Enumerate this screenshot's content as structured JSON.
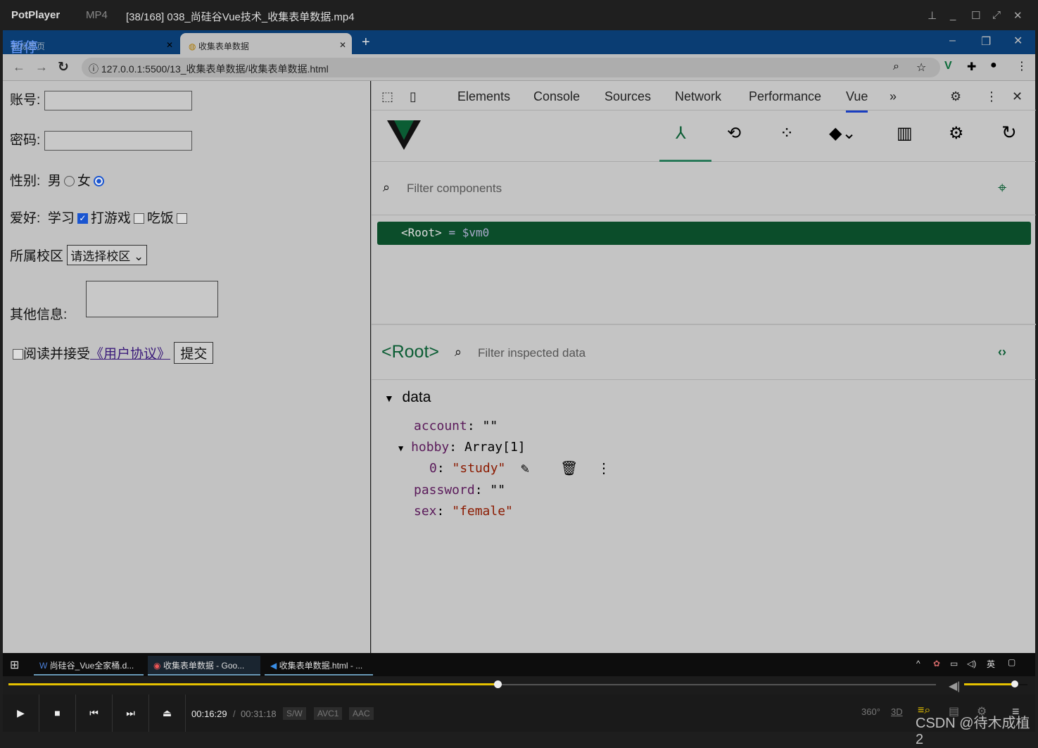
{
  "player": {
    "brand": "PotPlayer",
    "format": "MP4",
    "file_title": "[38/168] 038_尚硅谷Vue技术_收集表单数据.mp4",
    "overlay_status": "暂停"
  },
  "browser": {
    "tabs": [
      {
        "label": "新标签页"
      },
      {
        "label": "收集表单数据"
      }
    ],
    "url": "127.0.0.1:5500/13_收集表单数据/收集表单数据.html"
  },
  "form": {
    "account_label": "账号:",
    "password_label": "密码:",
    "sex_label": "性别:",
    "male": "男",
    "female": "女",
    "sex_value": "female",
    "hobby_label": "爱好:",
    "hobbies": [
      {
        "label": "学习",
        "checked": true
      },
      {
        "label": "打游戏",
        "checked": false
      },
      {
        "label": "吃饭",
        "checked": false
      }
    ],
    "campus_label": "所属校区",
    "campus_select": "请选择校区",
    "other_label": "其他信息:",
    "agree_text": "阅读并接受",
    "agreement_link": "《用户协议》",
    "submit": "提交"
  },
  "devtools": {
    "tabs": [
      "Elements",
      "Console",
      "Sources",
      "Network",
      "Performance",
      "Vue"
    ],
    "active_tab": "Vue",
    "filter_components_placeholder": "Filter components",
    "root_row": "<Root>",
    "root_alias": "= $vm0",
    "inspector_title": "<Root>",
    "filter_inspected_placeholder": "Filter inspected data",
    "section": "data",
    "fields": [
      {
        "key": "account",
        "value": "\"\""
      },
      {
        "key": "hobby",
        "value": "Array[1]"
      },
      {
        "key": "0",
        "value": "\"study\""
      },
      {
        "key": "password",
        "value": "\"\""
      },
      {
        "key": "sex",
        "value": "\"female\""
      }
    ],
    "accent": "#0b4d2a"
  },
  "taskbar": {
    "items": [
      "尚硅谷_Vue全家桶.d...",
      "收集表单数据 - Goo...",
      "收集表单数据.html - ..."
    ],
    "ime": "英"
  },
  "playback": {
    "current": "00:16:29",
    "total": "00:31:18",
    "progress": 0.527,
    "volume": 0.8,
    "badges": [
      "S/W",
      "AVC1",
      "AAC"
    ],
    "extra": [
      "360°",
      "3D"
    ]
  },
  "watermark": "CSDN @待木成植2"
}
